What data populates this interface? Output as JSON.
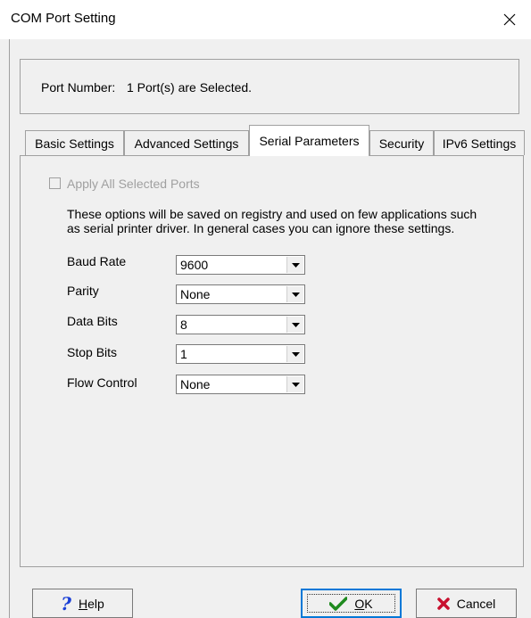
{
  "window": {
    "title": "COM Port Setting"
  },
  "port": {
    "label": "Port Number:",
    "value": "1 Port(s) are Selected."
  },
  "tabs": [
    {
      "label": "Basic Settings",
      "active": false
    },
    {
      "label": "Advanced Settings",
      "active": false
    },
    {
      "label": "Serial Parameters",
      "active": true
    },
    {
      "label": "Security",
      "active": false
    },
    {
      "label": "IPv6 Settings",
      "active": false
    }
  ],
  "apply_all": {
    "label": "Apply All Selected Ports",
    "checked": false,
    "enabled": false
  },
  "description": "These options will be saved on registry and used on few applications such as serial printer driver. In general cases you can ignore these settings.",
  "fields": [
    {
      "label": "Baud Rate",
      "value": "9600"
    },
    {
      "label": "Parity",
      "value": "None"
    },
    {
      "label": "Data Bits",
      "value": "8"
    },
    {
      "label": "Stop Bits",
      "value": "1"
    },
    {
      "label": "Flow Control",
      "value": "None"
    }
  ],
  "buttons": {
    "help": {
      "mnemonic": "H",
      "rest": "elp"
    },
    "ok": {
      "mnemonic": "O",
      "rest": "K"
    },
    "cancel": {
      "label": "Cancel"
    }
  }
}
